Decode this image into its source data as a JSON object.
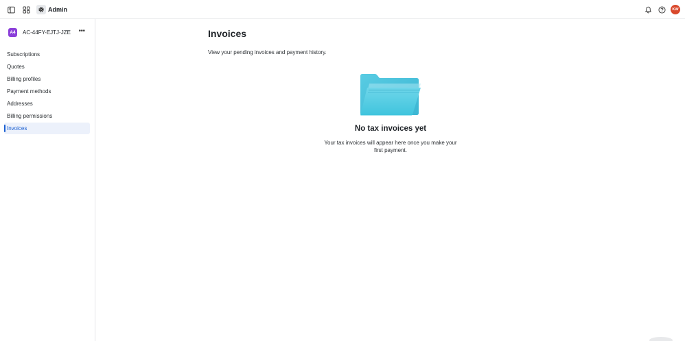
{
  "topbar": {
    "app_label": "Admin",
    "avatar_initials": "KW",
    "icons": [
      "sidebar-toggle-icon",
      "apps-grid-icon",
      "gear-icon",
      "bell-icon",
      "help-icon"
    ]
  },
  "account": {
    "badge": "A4",
    "name": "AC-44FY-EJTJ-JZE",
    "menu": "•••",
    "badge_color": "#8b3fd9"
  },
  "sidebar": {
    "items": [
      {
        "label": "Subscriptions"
      },
      {
        "label": "Quotes"
      },
      {
        "label": "Billing profiles"
      },
      {
        "label": "Payment methods"
      },
      {
        "label": "Addresses"
      },
      {
        "label": "Billing permissions"
      },
      {
        "label": "Invoices",
        "active": true
      }
    ],
    "active_color": "#1a5fd1"
  },
  "main": {
    "title": "Invoices",
    "subtitle": "View your pending invoices and payment history.",
    "empty_state": {
      "icon": "folder-icon",
      "title": "No tax invoices yet",
      "description": "Your tax invoices will appear here once you make your first payment."
    }
  },
  "colors": {
    "avatar": "#d9482b",
    "folder": "#3ec7df"
  }
}
